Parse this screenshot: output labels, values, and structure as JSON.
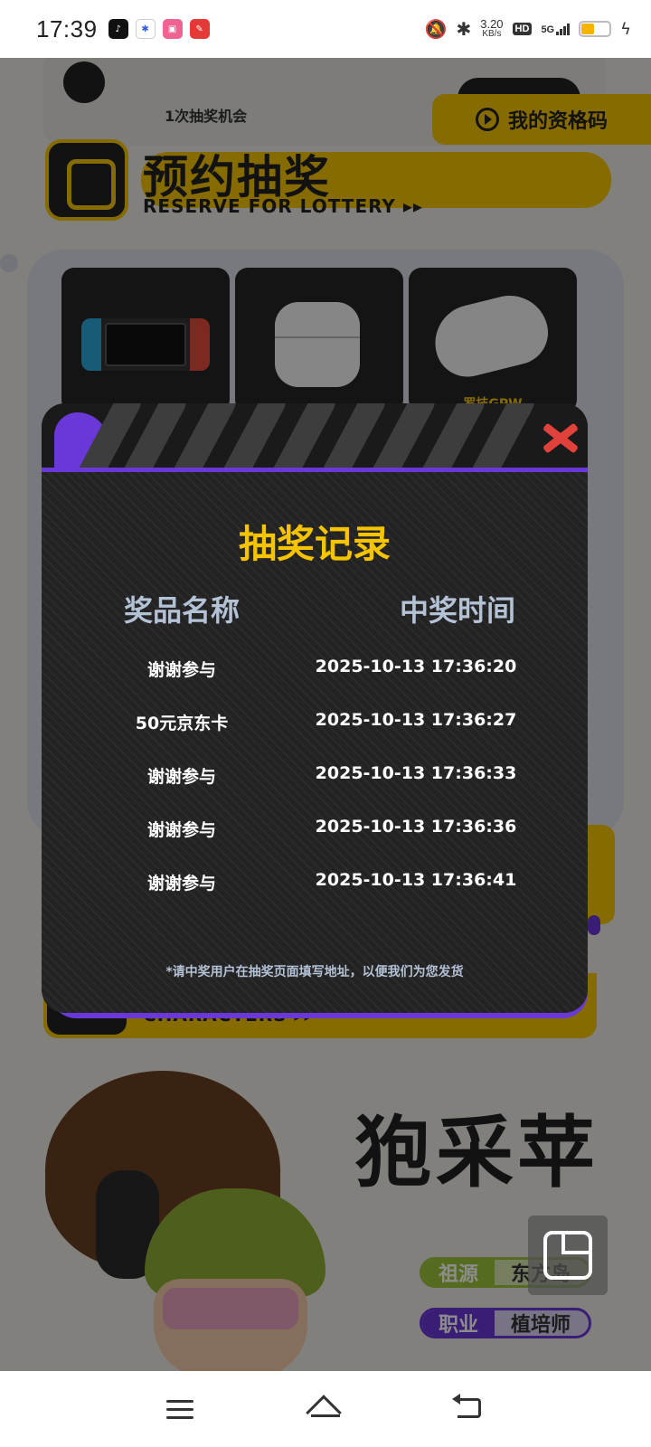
{
  "status_bar": {
    "time": "17:39",
    "net_speed_value": "3.20",
    "net_speed_unit": "KB/s",
    "hd_badge": "HD",
    "network": "5G",
    "battery_level": 0.45,
    "app_icons": [
      "tiktok-icon",
      "baidu-icon",
      "bilibili-icon",
      "xiaohongshu-icon"
    ]
  },
  "background": {
    "chance_text": "1次抽奖机会",
    "qualification_code_label": "我的资格码",
    "reserve_title": "预约抽奖",
    "reserve_subtitle": "RESERVE FOR LOTTERY ▸▸",
    "prize_caption": "罗技GPW",
    "characters_label": "CHARACTERS ▸▸",
    "character_name": "狍采苹",
    "tags": {
      "origin_key": "祖源",
      "origin_value": "东方岛",
      "job_key": "职业",
      "job_value": "植培师"
    }
  },
  "modal": {
    "title": "抽奖记录",
    "column_prize": "奖品名称",
    "column_time": "中奖时间",
    "records": [
      {
        "prize": "谢谢参与",
        "time": "2025-10-13 17:36:20"
      },
      {
        "prize": "50元京东卡",
        "time": "2025-10-13 17:36:27"
      },
      {
        "prize": "谢谢参与",
        "time": "2025-10-13 17:36:33"
      },
      {
        "prize": "谢谢参与",
        "time": "2025-10-13 17:36:36"
      },
      {
        "prize": "谢谢参与",
        "time": "2025-10-13 17:36:41"
      }
    ],
    "note": "*请中奖用户在抽奖页面填写地址，以便我们为您发货"
  },
  "colors": {
    "accent_yellow": "#f5c400",
    "accent_purple": "#6b38d8",
    "close_red": "#e0413a",
    "modal_bg": "#232323",
    "header_text": "#b4c2d6"
  }
}
